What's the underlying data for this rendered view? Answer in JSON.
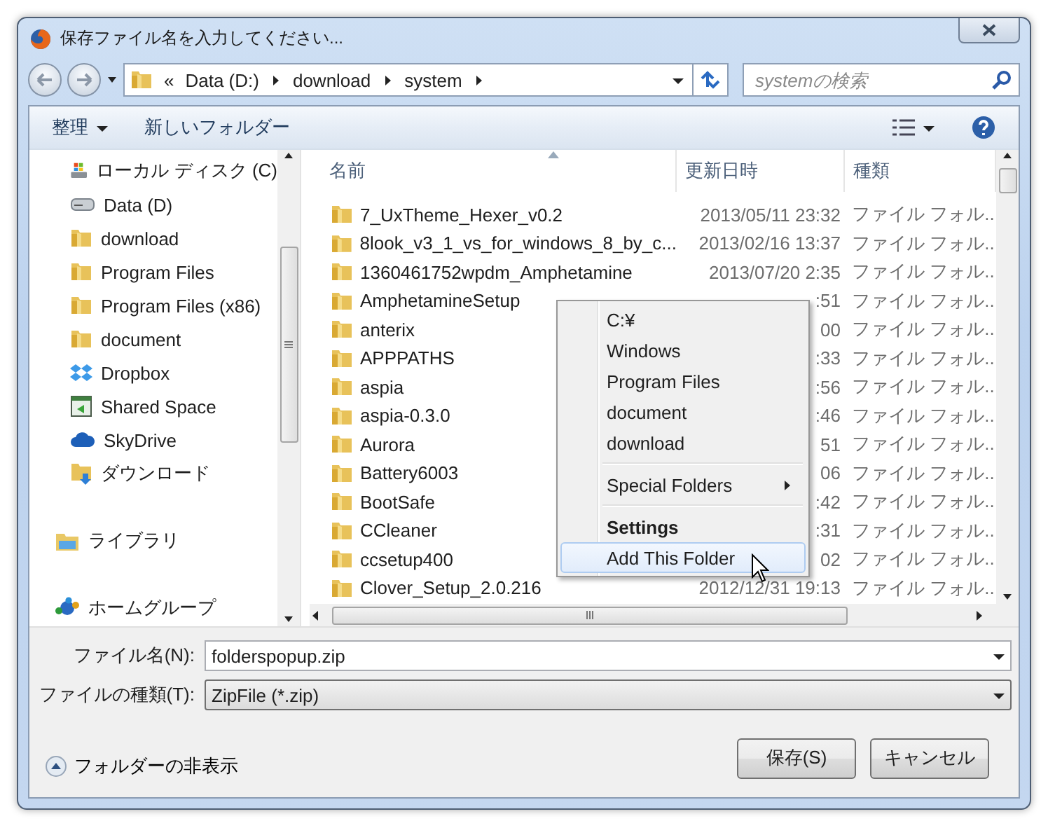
{
  "window": {
    "title": "保存ファイル名を入力してください..."
  },
  "address": {
    "overflow": "«",
    "crumbs": [
      "Data (D:)",
      "download",
      "system"
    ]
  },
  "search": {
    "placeholder": "systemの検索"
  },
  "toolbar": {
    "organize": "整理",
    "new_folder": "新しいフォルダー"
  },
  "sidebar": {
    "tree": [
      {
        "children": [
          {
            "label": "ローカル ディスク (C)",
            "kind": "system-drive"
          },
          {
            "label": "Data (D)",
            "kind": "drive"
          },
          {
            "label": "download",
            "kind": "folder"
          },
          {
            "label": "Program Files",
            "kind": "folder"
          },
          {
            "label": "Program Files (x86)",
            "kind": "folder"
          },
          {
            "label": "document",
            "kind": "folder"
          },
          {
            "label": "Dropbox",
            "kind": "dropbox"
          },
          {
            "label": "Shared Space",
            "kind": "shared"
          },
          {
            "label": "SkyDrive",
            "kind": "cloud"
          },
          {
            "label": "ダウンロード",
            "kind": "downloads"
          }
        ]
      },
      {
        "label": "ライブラリ",
        "kind": "library"
      },
      {
        "label": "ホームグループ",
        "kind": "homegroup"
      }
    ]
  },
  "table": {
    "columns": [
      {
        "label": "名前",
        "sorted": true
      },
      {
        "label": "更新日時",
        "sorted": false
      },
      {
        "label": "種類",
        "sorted": false
      }
    ],
    "rows": [
      {
        "name": "7_UxTheme_Hexer_v0.2",
        "date": "2013/05/11 23:32",
        "type": "ファイル フォル.."
      },
      {
        "name": "8look_v3_1_vs_for_windows_8_by_c...",
        "date": "2013/02/16 13:37",
        "type": "ファイル フォル.."
      },
      {
        "name": "1360461752wpdm_Amphetamine",
        "date": "2013/07/20 2:35",
        "type": "ファイル フォル.."
      },
      {
        "name": "AmphetamineSetup",
        "date": ":51",
        "type": "ファイル フォル.."
      },
      {
        "name": "anterix",
        "date": "00",
        "type": "ファイル フォル.."
      },
      {
        "name": "APPPATHS",
        "date": ":33",
        "type": "ファイル フォル.."
      },
      {
        "name": "aspia",
        "date": ":56",
        "type": "ファイル フォル.."
      },
      {
        "name": "aspia-0.3.0",
        "date": ":46",
        "type": "ファイル フォル.."
      },
      {
        "name": "Aurora",
        "date": "51",
        "type": "ファイル フォル.."
      },
      {
        "name": "Battery6003",
        "date": "06",
        "type": "ファイル フォル.."
      },
      {
        "name": "BootSafe",
        "date": ":42",
        "type": "ファイル フォル.."
      },
      {
        "name": "CCleaner",
        "date": ":31",
        "type": "ファイル フォル.."
      },
      {
        "name": "ccsetup400",
        "date": "02",
        "type": "ファイル フォル.."
      },
      {
        "name": "Clover_Setup_2.0.216",
        "date": "2012/12/31 19:13",
        "type": "ファイル フォル.."
      }
    ]
  },
  "context_menu": {
    "items": [
      {
        "kind": "item",
        "label": "C:¥",
        "selected": false
      },
      {
        "kind": "item",
        "label": "Windows",
        "selected": false
      },
      {
        "kind": "item",
        "label": "Program Files",
        "selected": false
      },
      {
        "kind": "item",
        "label": "document",
        "selected": false
      },
      {
        "kind": "item",
        "label": "download",
        "selected": false
      },
      {
        "kind": "separator"
      },
      {
        "kind": "submenu",
        "label": "Special Folders",
        "selected": false
      },
      {
        "kind": "separator"
      },
      {
        "kind": "header",
        "label": "Settings",
        "selected": false
      },
      {
        "kind": "item",
        "label": "Add This Folder",
        "selected": true
      }
    ]
  },
  "form": {
    "filename_label": "ファイル名(N):",
    "filename": "folderspopup.zip",
    "type_label": "ファイルの種類(T):",
    "type": "ZipFile (*.zip)"
  },
  "footer": {
    "hide_folders": "フォルダーの非表示",
    "buttons": [
      "保存(S)",
      "キャンセル"
    ]
  }
}
